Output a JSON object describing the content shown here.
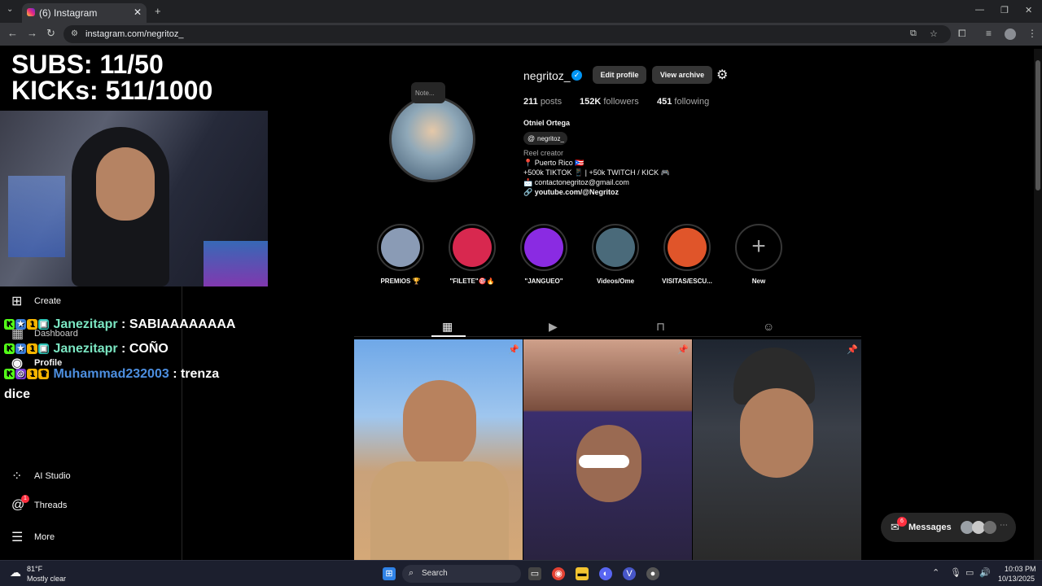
{
  "browser": {
    "tab_title": "(6) Instagram",
    "url": "instagram.com/negritoz_",
    "new_tab": "+",
    "close_tab": "✕"
  },
  "overlay": {
    "subs": "SUBS: 11/50",
    "kicks": "KICKs: 511/1000"
  },
  "sidebar": {
    "create": "Create",
    "dashboard": "Dashboard",
    "profile": "Profile",
    "ai_studio": "AI Studio",
    "threads": "Threads",
    "threads_badge": "1",
    "more": "More"
  },
  "chat": [
    {
      "user": "Janezitapr",
      "message": ": SABIAAAAAAAA"
    },
    {
      "user": "Janezitapr",
      "message": ": COÑO"
    },
    {
      "user": "Muhammad232003",
      "message": ": trenza",
      "continuation": "dice"
    }
  ],
  "profile": {
    "note_label": "Note...",
    "username": "negritoz_",
    "edit_profile": "Edit profile",
    "view_archive": "View archive",
    "posts_count": "211",
    "posts_label": "posts",
    "followers_count": "152K",
    "followers_label": "followers",
    "following_count": "451",
    "following_label": "following",
    "full_name": "Otniel Ortega",
    "threads_handle": "negritoz_",
    "category": "Reel creator",
    "bio_line1": "📍 Puerto Rico 🇵🇷",
    "bio_line2": "+500k TIKTOK 📱 | +50k TWITCH / KICK 🎮",
    "bio_line3": "📩 contactonegritoz@gmail.com",
    "link": "🔗 youtube.com/@Negritoz"
  },
  "highlights": [
    {
      "label": "PREMIOS 🏆",
      "color": "#8a9bb5"
    },
    {
      "label": "\"FILETE\"🎯🔥",
      "color": "#d8284f"
    },
    {
      "label": "\"JANGUEO\"",
      "color": "#8a2be2"
    },
    {
      "label": "Videos/Ome",
      "color": "#4a6a7a"
    },
    {
      "label": "VISITAS/ESCU...",
      "color": "#e0552a"
    },
    {
      "label": "New",
      "color": "#000000"
    }
  ],
  "messages": {
    "label": "Messages",
    "count": "6"
  },
  "taskbar": {
    "temp": "81°F",
    "weather": "Mostly clear",
    "search": "Search",
    "time": "10:03 PM",
    "date": "10/13/2025"
  }
}
